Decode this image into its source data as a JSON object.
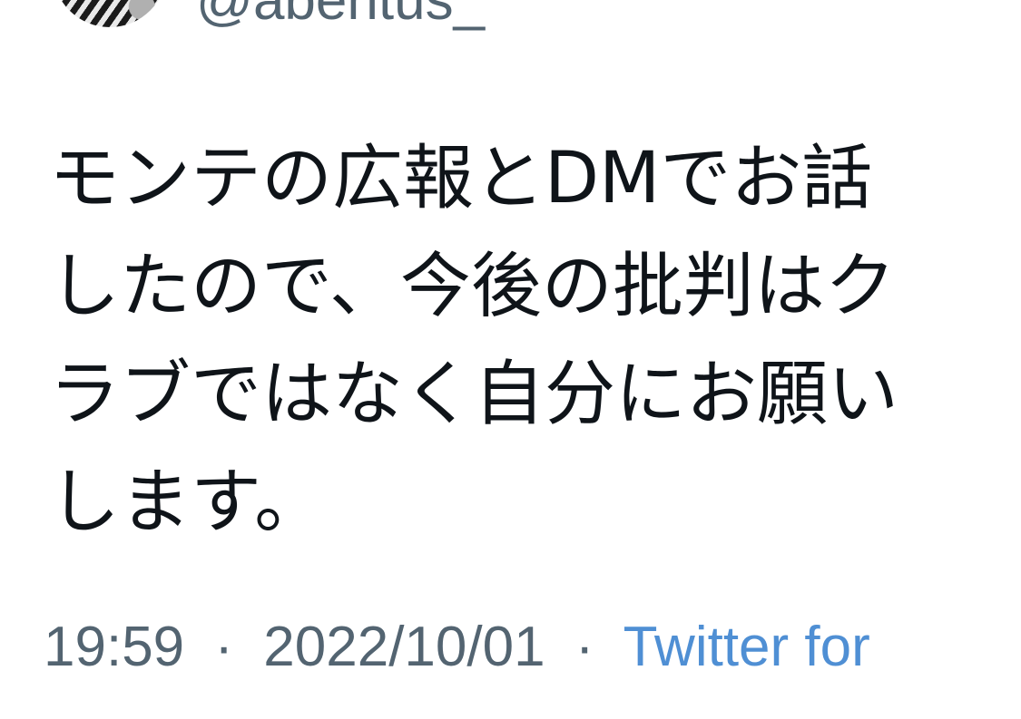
{
  "author": {
    "handle": "@abentus_"
  },
  "tweet": {
    "text": "モンテの広報とDMでお話\nしたので、今後の批判はク\nラブではなく自分にお願い\nします。"
  },
  "meta": {
    "time": "19:59",
    "date": "2022/10/01",
    "separator": "·",
    "source": "Twitter for"
  },
  "colors": {
    "text": "#0f1419",
    "secondary": "#536471",
    "link": "#4f8fd4"
  }
}
